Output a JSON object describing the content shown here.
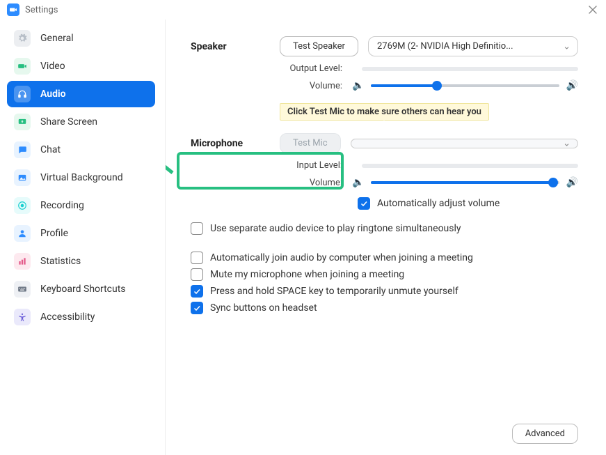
{
  "window": {
    "title": "Settings"
  },
  "sidebar": {
    "items": [
      {
        "label": "General"
      },
      {
        "label": "Video"
      },
      {
        "label": "Audio"
      },
      {
        "label": "Share Screen"
      },
      {
        "label": "Chat"
      },
      {
        "label": "Virtual Background"
      },
      {
        "label": "Recording"
      },
      {
        "label": "Profile"
      },
      {
        "label": "Statistics"
      },
      {
        "label": "Keyboard Shortcuts"
      },
      {
        "label": "Accessibility"
      }
    ],
    "active_index": 2
  },
  "speaker": {
    "section": "Speaker",
    "test_btn": "Test Speaker",
    "device": "2769M (2- NVIDIA High Definitio...",
    "output_level_label": "Output Level:",
    "volume_label": "Volume:",
    "volume_pct": 35
  },
  "mic": {
    "section": "Microphone",
    "test_btn": "Test Mic",
    "hint": "Click Test Mic to make sure others can hear you",
    "input_level_label": "Input Level:",
    "volume_label": "Volume:",
    "volume_pct": 97,
    "auto_adjust": "Automatically adjust volume"
  },
  "options": {
    "separate_device": "Use separate audio device to play ringtone simultaneously",
    "auto_join": "Automatically join audio by computer when joining a meeting",
    "mute_on_join": "Mute my microphone when joining a meeting",
    "space_unmute": "Press and hold SPACE key to temporarily unmute yourself",
    "sync_headset": "Sync buttons on headset"
  },
  "advanced_btn": "Advanced"
}
